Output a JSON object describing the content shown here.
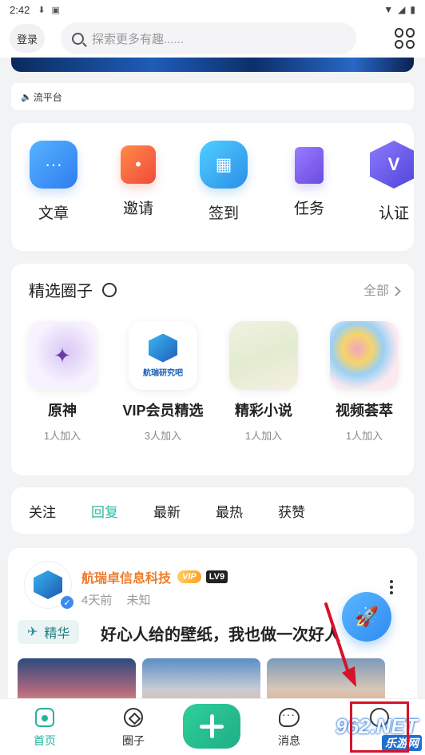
{
  "status_bar": {
    "time": "2:42"
  },
  "top_bar": {
    "login_label": "登录",
    "search_placeholder": "探索更多有趣......"
  },
  "notice": {
    "text": "流平台"
  },
  "features": [
    {
      "label": "文章",
      "icon": "article-icon"
    },
    {
      "label": "邀请",
      "icon": "invite-icon"
    },
    {
      "label": "签到",
      "icon": "checkin-icon"
    },
    {
      "label": "任务",
      "icon": "task-icon"
    },
    {
      "label": "认证",
      "icon": "verify-icon"
    }
  ],
  "circles": {
    "title": "精选圈子",
    "all_label": "全部",
    "items": [
      {
        "name": "原神",
        "count": "1人加入"
      },
      {
        "name": "VIP会员精选",
        "count": "3人加入",
        "thumb_text": "航瑞研究吧"
      },
      {
        "name": "精彩小说",
        "count": "1人加入"
      },
      {
        "name": "视频荟萃",
        "count": "1人加入"
      }
    ]
  },
  "tabs": [
    {
      "label": "关注",
      "active": false
    },
    {
      "label": "回复",
      "active": true
    },
    {
      "label": "最新",
      "active": false
    },
    {
      "label": "最热",
      "active": false
    },
    {
      "label": "获赞",
      "active": false
    }
  ],
  "post": {
    "author": "航瑞卓信息科技",
    "vip_badge": "VIP",
    "level": "LV9",
    "time": "4天前",
    "location": "未知",
    "tag": "精华",
    "title": "好心人给的壁纸，我也做一次好人"
  },
  "nav": {
    "home": "首页",
    "circle": "圈子",
    "messages": "消息"
  },
  "watermark": {
    "main": "962.NET",
    "sub": "乐游网"
  },
  "colors": {
    "accent": "#25b39c",
    "active_tab": "#2bb8a4",
    "author": "#f07a2a",
    "highlight": "#d4142a"
  }
}
